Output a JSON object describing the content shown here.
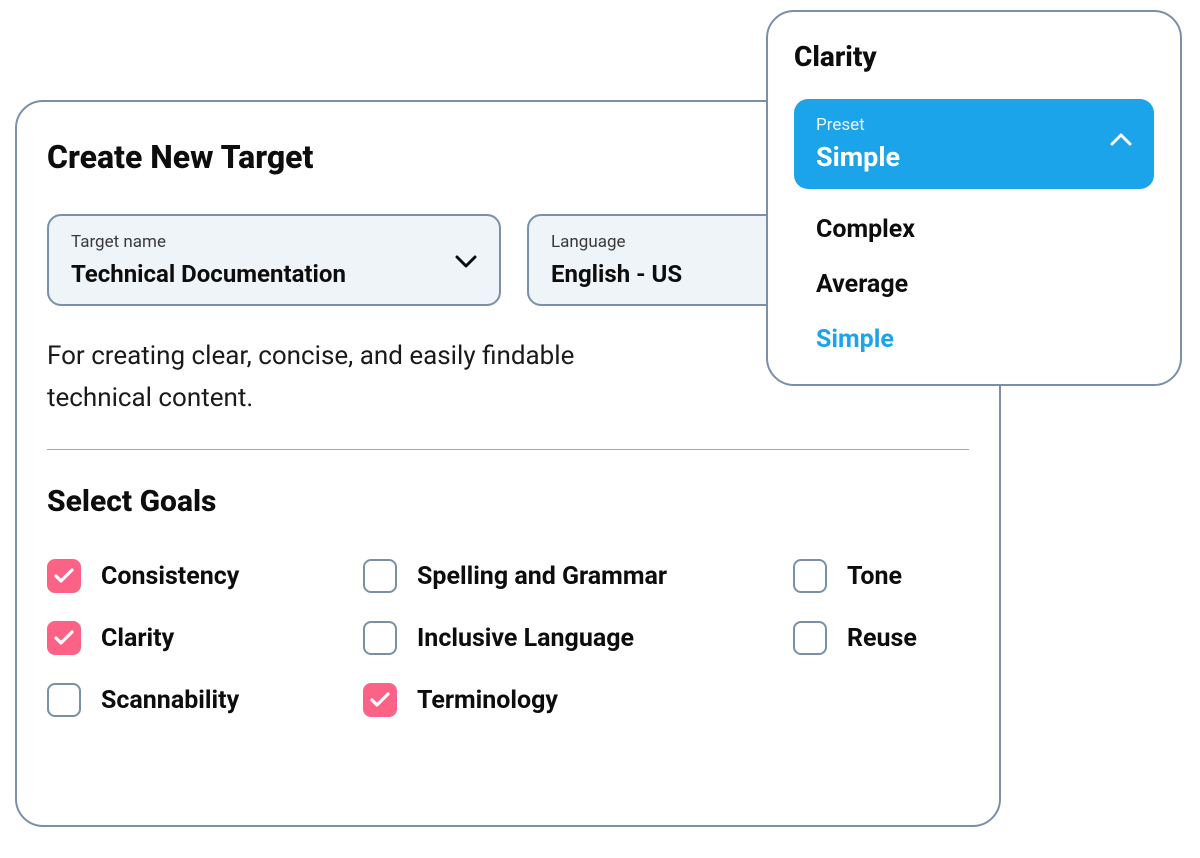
{
  "main": {
    "title": "Create New Target",
    "targetName": {
      "label": "Target name",
      "value": "Technical Documentation"
    },
    "language": {
      "label": "Language",
      "value": "English - US"
    },
    "description": "For creating clear, concise, and easily findable technical content.",
    "goals": {
      "title": "Select Goals",
      "items": [
        {
          "label": "Consistency",
          "checked": true
        },
        {
          "label": "Spelling and Grammar",
          "checked": false
        },
        {
          "label": "Tone",
          "checked": false
        },
        {
          "label": "Clarity",
          "checked": true
        },
        {
          "label": "Inclusive Language",
          "checked": false
        },
        {
          "label": "Reuse",
          "checked": false
        },
        {
          "label": "Scannability",
          "checked": false
        },
        {
          "label": "Terminology",
          "checked": true
        }
      ]
    }
  },
  "clarityPanel": {
    "title": "Clarity",
    "preset": {
      "label": "Preset",
      "value": "Simple"
    },
    "options": [
      {
        "label": "Complex",
        "active": false
      },
      {
        "label": "Average",
        "active": false
      },
      {
        "label": "Simple",
        "active": true
      }
    ]
  }
}
